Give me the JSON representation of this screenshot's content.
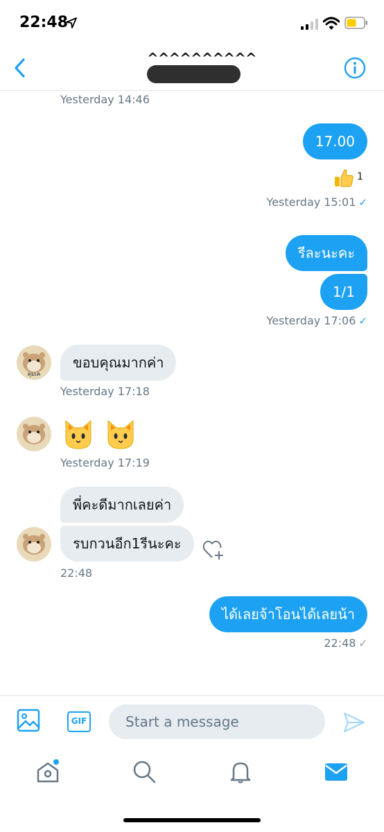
{
  "status_bar": {
    "time": "22:48",
    "battery_color": "#ffcc00"
  },
  "header": {
    "name": "^^^^^^^^^^",
    "back_icon": "chevron-left-icon",
    "info_icon": "info-icon"
  },
  "messages": [
    {
      "type": "timestamp",
      "text": "Yesterday 14:46"
    },
    {
      "type": "outgoing",
      "text": "17.00",
      "reaction": {
        "emoji": "thumbs-up",
        "count": "1"
      }
    },
    {
      "type": "timestamp",
      "text": "Yesterday 15:01",
      "check": "✓"
    },
    {
      "type": "outgoing",
      "text": "รีละนะคะ"
    },
    {
      "type": "outgoing",
      "text": "1/1"
    },
    {
      "type": "timestamp",
      "text": "Yesterday 17:06",
      "check": "✓"
    },
    {
      "type": "incoming",
      "text": "ขอบคุณมากค่า"
    },
    {
      "type": "timestamp",
      "text": "Yesterday 17:18"
    },
    {
      "type": "incoming",
      "emoji": [
        "cat-face",
        "cat-face"
      ]
    },
    {
      "type": "timestamp",
      "text": "Yesterday 17:19"
    },
    {
      "type": "incoming",
      "text": "พี่คะดีมากเลยค่า"
    },
    {
      "type": "incoming",
      "text": "รบกวนอีก1รีนะคะ"
    },
    {
      "type": "timestamp",
      "text": "22:48"
    },
    {
      "type": "outgoing",
      "text": "ได้เลยจ้าโอนได้เลยน้า"
    },
    {
      "type": "timestamp",
      "text": "22:48",
      "check": "✓"
    }
  ],
  "avatar_text": "คุมเค",
  "composer": {
    "placeholder": "Start a message",
    "gif_label": "GIF"
  },
  "colors": {
    "accent": "#1da1f2",
    "incoming_bubble": "#e6ecf0",
    "muted": "#657786"
  }
}
